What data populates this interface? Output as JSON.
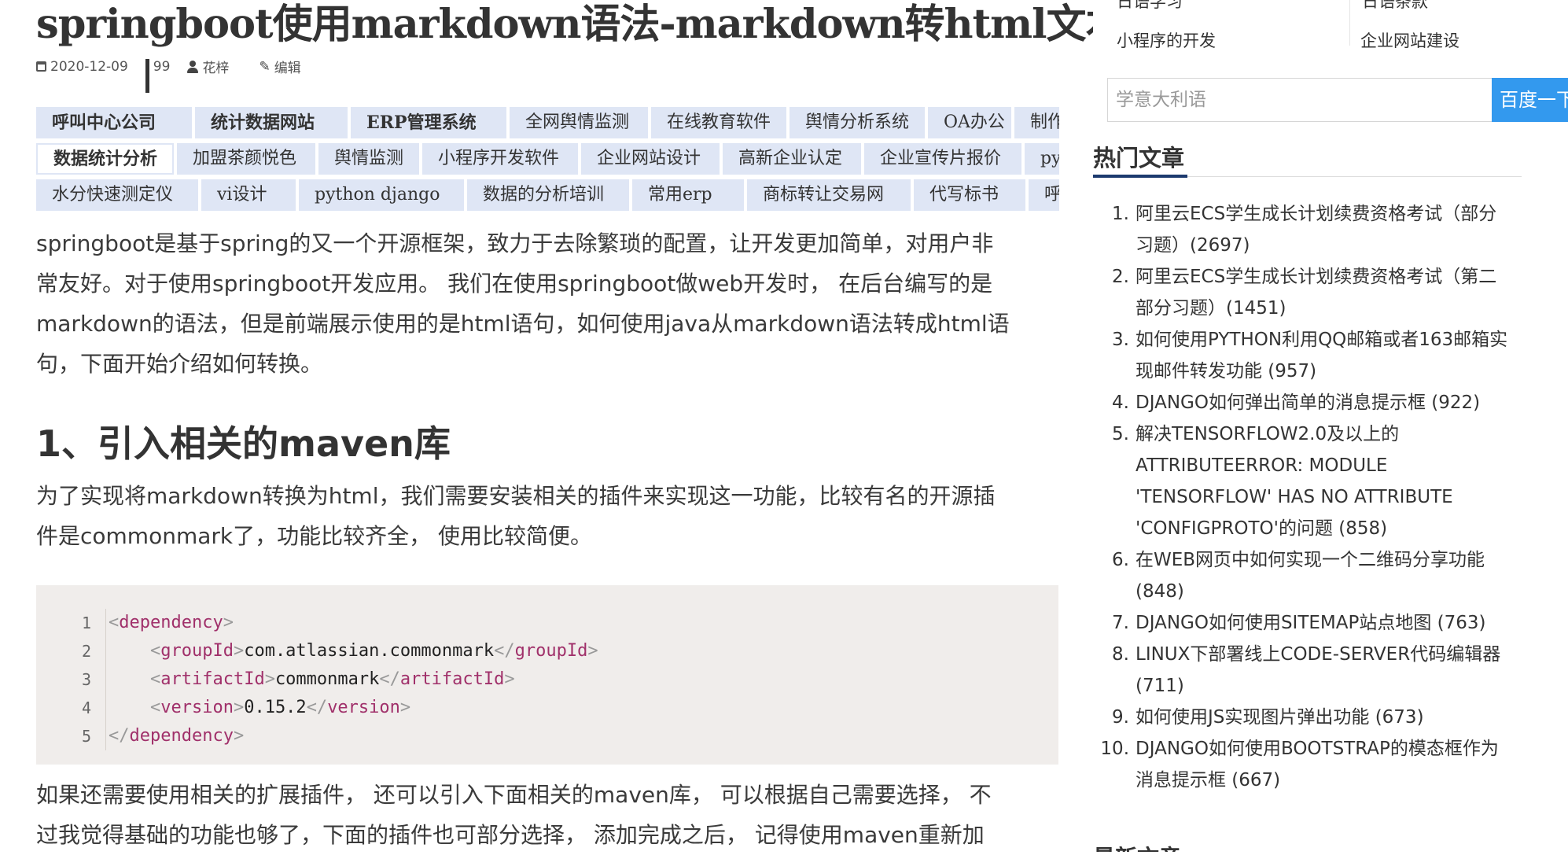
{
  "article": {
    "title": "springboot使用markdown语法-markdown转html文本",
    "meta": {
      "date": "2020-12-09",
      "views": "99",
      "author": "花梓",
      "edit_label": "编辑"
    },
    "tags_rows": [
      [
        {
          "label": "呼叫中心公司",
          "style": "bold"
        },
        {
          "label": "统计数据网站",
          "style": "bold"
        },
        {
          "label": "ERP管理系统",
          "style": "bold"
        },
        {
          "label": "全网舆情监测",
          "style": "normal"
        },
        {
          "label": "在线教育软件",
          "style": "normal"
        },
        {
          "label": "舆情分析系统",
          "style": "normal"
        },
        {
          "label": "OA办公",
          "style": "normal"
        },
        {
          "label": "制作",
          "style": "normal"
        }
      ],
      [
        {
          "label": "数据统计分析",
          "style": "white"
        },
        {
          "label": "加盟茶颜悦色",
          "style": "normal"
        },
        {
          "label": "舆情监测",
          "style": "normal"
        },
        {
          "label": "小程序开发软件",
          "style": "normal"
        },
        {
          "label": "企业网站设计",
          "style": "normal"
        },
        {
          "label": "高新企业认定",
          "style": "normal"
        },
        {
          "label": "企业宣传片报价",
          "style": "normal"
        },
        {
          "label": "py",
          "style": "normal"
        }
      ],
      [
        {
          "label": "水分快速测定仪",
          "style": "normal"
        },
        {
          "label": "vi设计",
          "style": "normal"
        },
        {
          "label": "python django",
          "style": "normal"
        },
        {
          "label": "数据的分析培训",
          "style": "normal"
        },
        {
          "label": "常用erp",
          "style": "normal"
        },
        {
          "label": "商标转让交易网",
          "style": "normal"
        },
        {
          "label": "代写标书",
          "style": "normal"
        },
        {
          "label": "呼",
          "style": "normal"
        }
      ]
    ],
    "intro_lines": [
      "springboot是基于spring的又一个开源框架，致力于去除繁琐的配置，让开发更加简单，对用户非",
      "常友好。对于使用springboot开发应用。 我们在使用springboot做web开发时， 在后台编写的是",
      "markdown的语法，但是前端展示使用的是html语句，如何使用java从markdown语法转成html语",
      "句，下面开始介绍如何转换。"
    ],
    "section1_heading": "1、引入相关的maven库",
    "section1_lines": [
      "为了实现将markdown转换为html，我们需要安装相关的插件来实现这一功能，比较有名的开源插",
      "件是commonmark了，功能比较齐全， 使用比较简便。"
    ],
    "code": {
      "line_numbers": [
        "1",
        "2",
        "3",
        "4",
        "5"
      ],
      "tags": {
        "dependency": "dependency",
        "groupId": "groupId",
        "artifactId": "artifactId",
        "version": "version"
      },
      "values": {
        "groupId": "com.atlassian.commonmark",
        "artifactId": "commonmark",
        "version": "0.15.2"
      }
    },
    "after_code_lines": [
      "如果还需要使用相关的扩展插件， 还可以引入下面相关的maven库， 可以根据自己需要选择， 不",
      "过我觉得基础的功能也够了，下面的插件也可部分选择， 添加完成之后， 记得使用maven重新加"
    ]
  },
  "sidebar": {
    "top_partial": {
      "left": "日语学习",
      "right": "日语条款"
    },
    "links": {
      "left": "小程序的开发",
      "right": "企业网站建设"
    },
    "search": {
      "placeholder": "学意大利语",
      "button_label": "百度一下"
    },
    "hot_title": "热门文章",
    "hot_articles": [
      {
        "num": "1.",
        "line1": "阿里云ECS学生成长计划续费资格考试（部分",
        "line2": "习题）(2697)"
      },
      {
        "num": "2.",
        "line1": "阿里云ECS学生成长计划续费资格考试（第二",
        "line2": "部分习题）(1451)"
      },
      {
        "num": "3.",
        "line1": "如何使用PYTHON利用QQ邮箱或者163邮箱实",
        "line2": "现邮件转发功能 (957)"
      },
      {
        "num": "4.",
        "line1": "DJANGO如何弹出简单的消息提示框 (922)"
      },
      {
        "num": "5.",
        "line1": "解决TENSORFLOW2.0及以上的",
        "line2": "ATTRIBUTEERROR: MODULE",
        "line3": "'TENSORFLOW' HAS NO ATTRIBUTE",
        "line4": "'CONFIGPROTO'的问题 (858)"
      },
      {
        "num": "6.",
        "line1": "在WEB网页中如何实现一个二维码分享功能",
        "line2": "(848)"
      },
      {
        "num": "7.",
        "line1": "DJANGO如何使用SITEMAP站点地图 (763)"
      },
      {
        "num": "8.",
        "line1": "LINUX下部署线上CODE-SERVER代码编辑器",
        "line2": "(711)"
      },
      {
        "num": "9.",
        "line1": "如何使用JS实现图片弹出功能 (673)"
      },
      {
        "num": "10.",
        "line1": "DJANGO如何使用BOOTSTRAP的模态框作为",
        "line2": "消息提示框 (667)"
      }
    ],
    "bottom_partial": "最新文章"
  }
}
